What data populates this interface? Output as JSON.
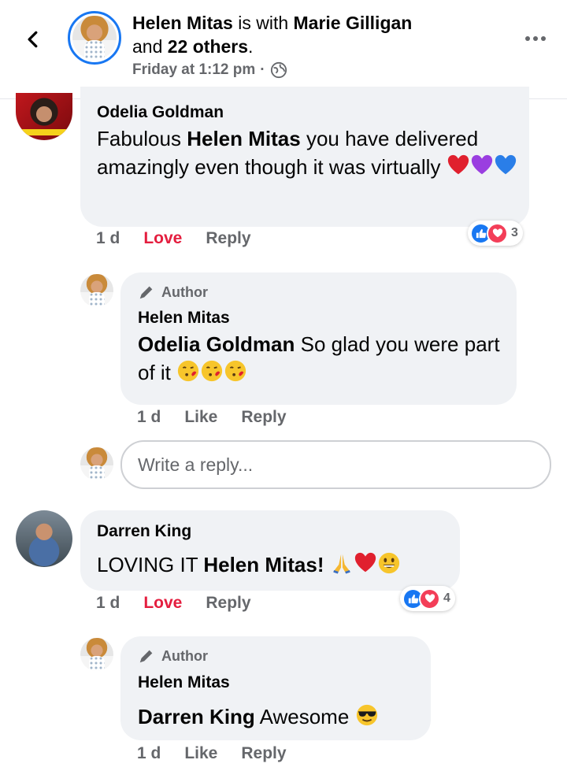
{
  "header": {
    "poster": "Helen Mitas",
    "with_text": "is with",
    "tagged": "Marie Gilligan",
    "and_text": "and",
    "others": "22 others",
    "period": ".",
    "timestamp": "Friday at 1:12 pm",
    "dot": "·"
  },
  "comments": [
    {
      "author": "Odelia Goldman",
      "text_pre": "Fabulous",
      "mention": "Helen Mitas",
      "text_post": "you have delivered amazingly even though it was virtually",
      "emojis": [
        "red-heart",
        "purple-heart",
        "blue-heart"
      ],
      "time": "1 d",
      "reaction_state": "Love",
      "reply_label": "Reply",
      "reaction_count": "3",
      "reaction_types": [
        "like",
        "love"
      ]
    },
    {
      "badge": "Author",
      "author": "Helen Mitas",
      "mention": "Odelia Goldman",
      "text_post": "So glad you were part of it",
      "emojis": [
        "kiss-face",
        "kiss-face",
        "kiss-face"
      ],
      "time": "1 d",
      "like_label": "Like",
      "reply_label": "Reply"
    },
    {
      "author": "Darren King",
      "text_pre": "LOVING IT",
      "mention": "Helen Mitas!",
      "emojis": [
        "folded-hands",
        "red-heart",
        "grinning-face"
      ],
      "time": "1 d",
      "reaction_state": "Love",
      "reply_label": "Reply",
      "reaction_count": "4",
      "reaction_types": [
        "like",
        "love"
      ]
    },
    {
      "badge": "Author",
      "author": "Helen Mitas",
      "mention": "Darren King",
      "text_post": "Awesome",
      "emojis": [
        "sunglasses-face"
      ],
      "time": "1 d",
      "like_label": "Like",
      "reply_label": "Reply"
    }
  ],
  "reply_input": {
    "placeholder": "Write a reply..."
  },
  "colors": {
    "accent": "#1877f2",
    "love": "#e41e3f",
    "bubble": "#f0f2f5",
    "muted": "#65676b"
  }
}
